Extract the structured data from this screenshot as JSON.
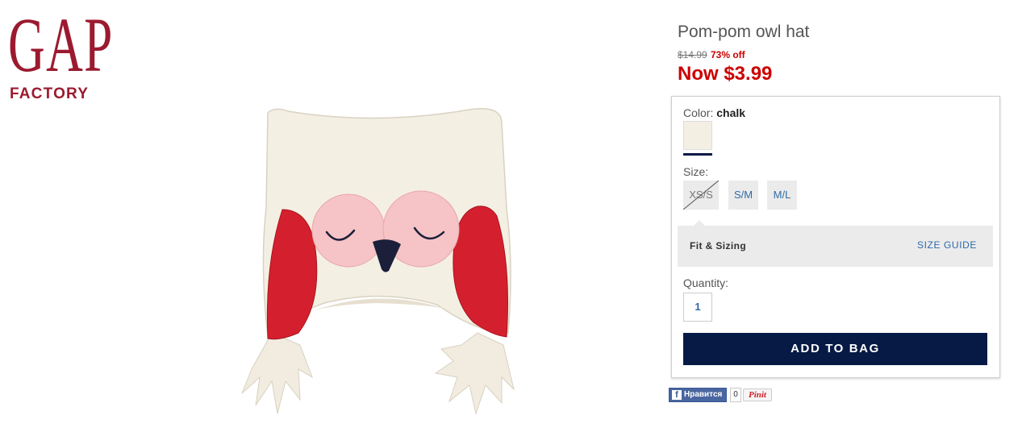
{
  "brand": {
    "logo_text": "GAP",
    "logo_sub": "FACTORY",
    "color": "#9b1a2f"
  },
  "product": {
    "title": "Pom-pom owl hat",
    "original_price": "$14.99",
    "discount": "73% off",
    "now_price": "Now $3.99",
    "image_description": "cream fleece owl hat with pink eye patches, red ear flaps and fringe tassels"
  },
  "options": {
    "color_label": "Color:",
    "color_value": "chalk",
    "swatch_color": "#f4efe3",
    "size_label": "Size:",
    "sizes": [
      {
        "label": "XS/S",
        "available": false
      },
      {
        "label": "S/M",
        "available": true
      },
      {
        "label": "M/L",
        "available": true
      }
    ],
    "fit_label": "Fit & Sizing",
    "size_guide": "SIZE GUIDE",
    "quantity_label": "Quantity:",
    "quantity_value": "1",
    "add_to_bag": "ADD TO BAG"
  },
  "social": {
    "fb_label": "Нравится",
    "fb_count": "0",
    "pin_label": "Pinit"
  },
  "colors": {
    "price_red": "#cc0000",
    "link_blue": "#2e6aa8",
    "button_navy": "#061a45",
    "panel_gray": "#ebebeb"
  }
}
